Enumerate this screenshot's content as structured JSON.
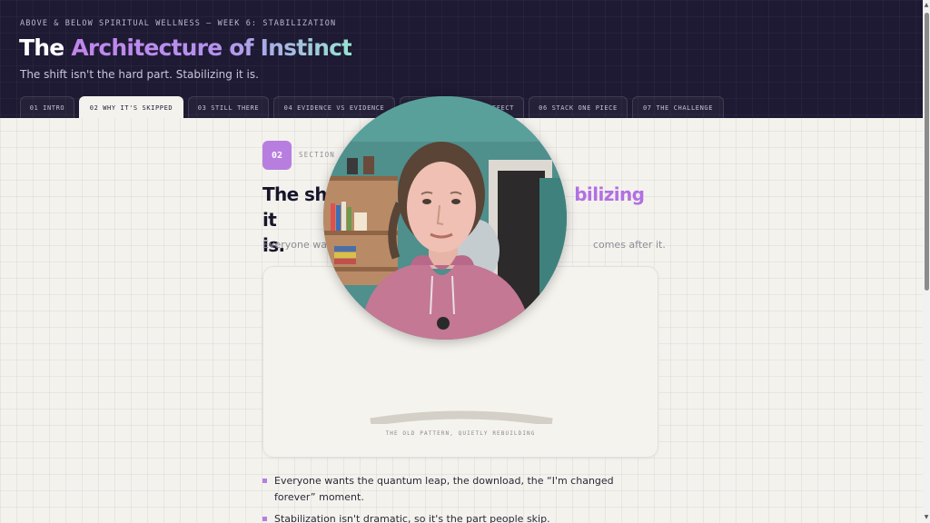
{
  "header": {
    "eyebrow": "ABOVE & BELOW SPIRITUAL WELLNESS — WEEK 6: STABILIZATION",
    "title_plain": "The",
    "title_accent": "Architecture of Instinct",
    "subtitle": "The shift isn't the hard part. Stabilizing it is."
  },
  "tabs": [
    {
      "label": "01 INTRO",
      "active": false
    },
    {
      "label": "02 WHY IT'S SKIPPED",
      "active": true
    },
    {
      "label": "03 STILL THERE",
      "active": false
    },
    {
      "label": "04 EVIDENCE VS EVIDENCE",
      "active": false
    },
    {
      "label": "…EFFECT",
      "active": false
    },
    {
      "label": "06 STACK ONE PIECE",
      "active": false
    },
    {
      "label": "07 THE CHALLENGE",
      "active": false
    }
  ],
  "section": {
    "number": "02",
    "label": "SECTION",
    "heading_start": "The shi",
    "heading_accent": "bilizing",
    "heading_mid": " it",
    "heading_end": "is.",
    "lede_start": "Everyone wan",
    "lede_end": "comes after it."
  },
  "card": {
    "caption": "THE OLD PATTERN, QUIETLY REBUILDING"
  },
  "bullets": [
    "Everyone wants the quantum leap, the download, the “I'm changed forever” moment.",
    "Stabilization isn't dramatic, so it's the part people skip."
  ],
  "colors": {
    "header_bg": "#1e1a33",
    "accent_purple": "#b77ee0",
    "accent_mint": "#97e3d2",
    "page_bg": "#f4f2ed"
  },
  "webcam": {
    "description_icon": "person-video-icon"
  }
}
